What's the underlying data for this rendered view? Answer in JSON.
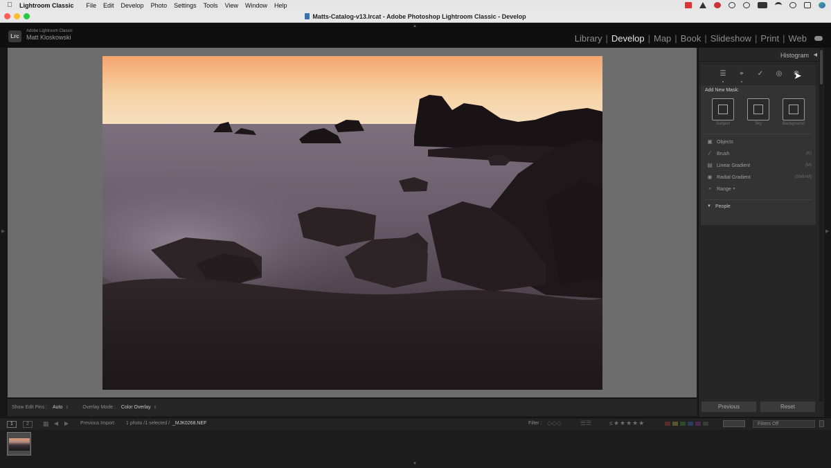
{
  "menubar": {
    "app_name": "Lightroom Classic",
    "items": [
      "File",
      "Edit",
      "Develop",
      "Photo",
      "Settings",
      "Tools",
      "View",
      "Window",
      "Help"
    ]
  },
  "window": {
    "title": "Matts-Catalog-v13.lrcat - Adobe Photoshop Lightroom Classic - Develop"
  },
  "identity": {
    "logo": "Lrc",
    "product": "Adobe Lightroom Classic",
    "user": "Matt Kloskowski"
  },
  "modules": {
    "library": "Library",
    "develop": "Develop",
    "map": "Map",
    "book": "Book",
    "slideshow": "Slideshow",
    "print": "Print",
    "web": "Web",
    "active": "Develop"
  },
  "toolbar": {
    "edit_pins_label": "Show Edit Pins :",
    "edit_pins_value": "Auto",
    "overlay_label": "Overlay Mode :",
    "overlay_value": "Color Overlay"
  },
  "right_panel": {
    "histogram_label": "Histogram",
    "tools": [
      "edit-sliders-icon",
      "crop-icon",
      "healing-icon",
      "red-eye-icon",
      "masking-icon"
    ],
    "mask": {
      "title": "Add New Mask:",
      "buttons": [
        {
          "label": "Subject",
          "icon": "subject-icon"
        },
        {
          "label": "Sky",
          "icon": "sky-icon"
        },
        {
          "label": "Background",
          "icon": "background-icon"
        }
      ],
      "items": [
        {
          "label": "Objects",
          "shortcut": ""
        },
        {
          "label": "Brush",
          "shortcut": "(K)"
        },
        {
          "label": "Linear Gradient",
          "shortcut": "(M)"
        },
        {
          "label": "Radial Gradient",
          "shortcut": "(Shift+M)"
        },
        {
          "label": "Range",
          "shortcut": ""
        }
      ],
      "people_label": "People"
    },
    "previous_button": "Previous",
    "reset_button": "Reset"
  },
  "filmstrip": {
    "page1": "1",
    "page2": "2",
    "source": "Previous Import",
    "selection": "1 photo /1 selected /",
    "filename": "_MJK0268.NEF",
    "filter_label": "Filter :",
    "filters_value": "Filters Off"
  },
  "colors": {
    "canvas": "#6d6d6d",
    "panel": "#262626",
    "active_module": "#e6e6e6"
  }
}
